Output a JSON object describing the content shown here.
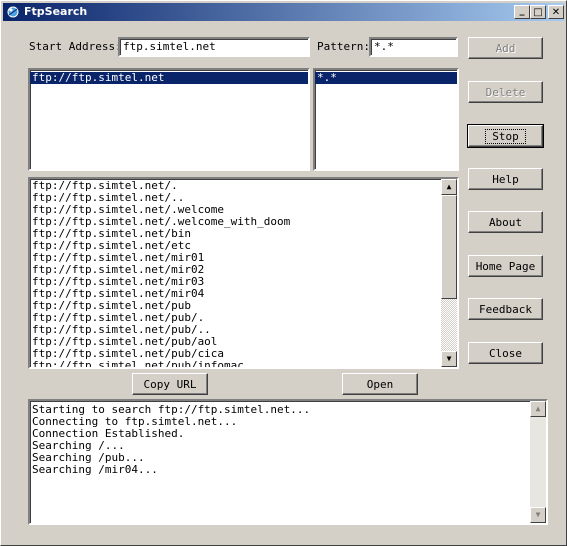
{
  "window": {
    "title": "FtpSearch",
    "controls": {
      "minimize": "_",
      "maximize": "□",
      "close": "✕"
    }
  },
  "form": {
    "start_address_label": "Start Address:",
    "start_address_value": "ftp.simtel.net",
    "pattern_label": "Pattern:",
    "pattern_value": "*.*"
  },
  "address_list": [
    "ftp://ftp.simtel.net"
  ],
  "pattern_list": [
    "*.*"
  ],
  "results": [
    "ftp://ftp.simtel.net/.",
    "ftp://ftp.simtel.net/..",
    "ftp://ftp.simtel.net/.welcome",
    "ftp://ftp.simtel.net/.welcome_with_doom",
    "ftp://ftp.simtel.net/bin",
    "ftp://ftp.simtel.net/etc",
    "ftp://ftp.simtel.net/mir01",
    "ftp://ftp.simtel.net/mir02",
    "ftp://ftp.simtel.net/mir03",
    "ftp://ftp.simtel.net/mir04",
    "ftp://ftp.simtel.net/pub",
    "ftp://ftp.simtel.net/pub/.",
    "ftp://ftp.simtel.net/pub/..",
    "ftp://ftp.simtel.net/pub/aol",
    "ftp://ftp.simtel.net/pub/cica",
    "ftp://ftp.simtel.net/pub/infomac"
  ],
  "buttons": {
    "add": "Add",
    "delete": "Delete",
    "stop": "Stop",
    "help": "Help",
    "about": "About",
    "home_page": "Home Page",
    "feedback": "Feedback",
    "close": "Close",
    "copy_url": "Copy URL",
    "open": "Open"
  },
  "log": [
    "Starting to search ftp://ftp.simtel.net...",
    "Connecting to ftp.simtel.net...",
    "Connection Established.",
    "Searching /...",
    "Searching /pub...",
    "Searching /mir04..."
  ],
  "colors": {
    "titlebar_start": "#0a246a",
    "titlebar_end": "#a6caf0",
    "selection": "#0a246a",
    "face": "#d4d0c8"
  }
}
